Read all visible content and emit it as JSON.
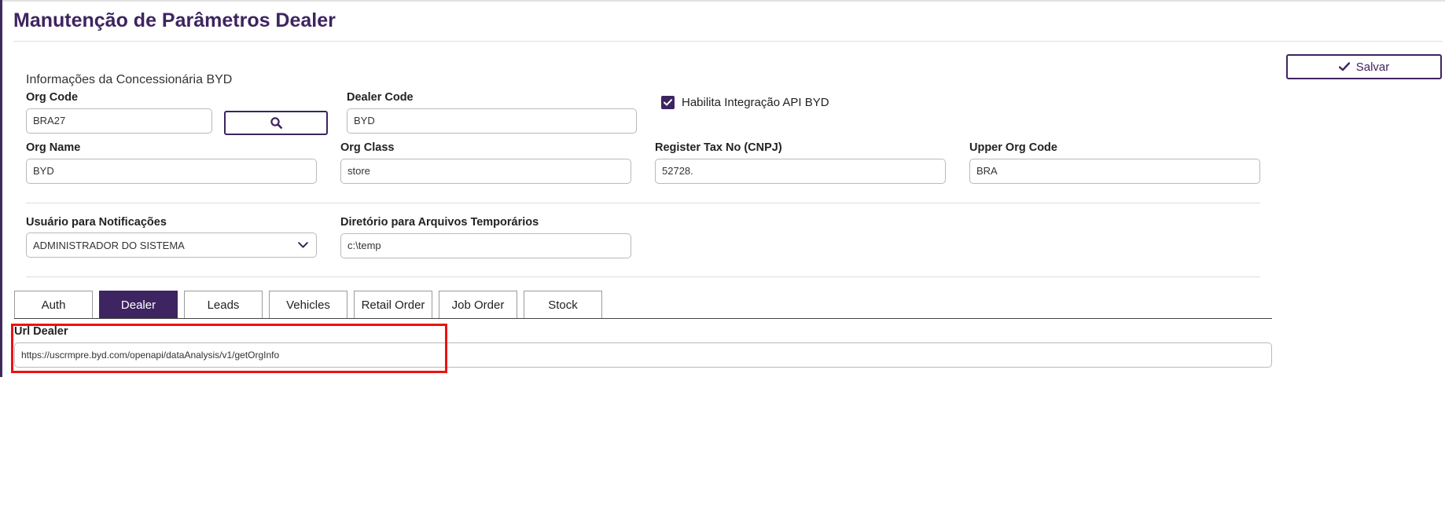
{
  "page": {
    "title": "Manutenção de Parâmetros Dealer",
    "save_label": "Salvar"
  },
  "dealer_info": {
    "section_title": "Informações da Concessionária BYD",
    "org_code": {
      "label": "Org Code",
      "value": "BRA27"
    },
    "dealer_code": {
      "label": "Dealer Code",
      "value": "BYD"
    },
    "api_integration": {
      "label": "Habilita Integração API BYD",
      "checked": true
    },
    "org_name": {
      "label": "Org Name",
      "value": "BYD"
    },
    "org_class": {
      "label": "Org Class",
      "value": "store"
    },
    "register_tax_no": {
      "label": "Register Tax No (CNPJ)",
      "value": "52728."
    },
    "upper_org_code": {
      "label": "Upper Org Code",
      "value": "BRA"
    }
  },
  "settings": {
    "notification_user": {
      "label": "Usuário para Notificações",
      "value": "ADMINISTRADOR DO SISTEMA"
    },
    "temp_dir": {
      "label": "Diretório para Arquivos Temporários",
      "value": "c:\\temp"
    }
  },
  "tabs": [
    {
      "label": "Auth",
      "active": false
    },
    {
      "label": "Dealer",
      "active": true
    },
    {
      "label": "Leads",
      "active": false
    },
    {
      "label": "Vehicles",
      "active": false
    },
    {
      "label": "Retail Order",
      "active": false
    },
    {
      "label": "Job Order",
      "active": false
    },
    {
      "label": "Stock",
      "active": false
    }
  ],
  "dealer_tab": {
    "url_label": "Url Dealer",
    "url_value": "https://uscrmpre.byd.com/openapi/dataAnalysis/v1/getOrgInfo"
  },
  "icons": {
    "search": "search-icon",
    "save": "check-icon",
    "checkbox": "checkbox-checked-icon",
    "dropdown": "chevron-down-icon"
  },
  "colors": {
    "brand": "#3e2460",
    "highlight": "#ee1111"
  }
}
